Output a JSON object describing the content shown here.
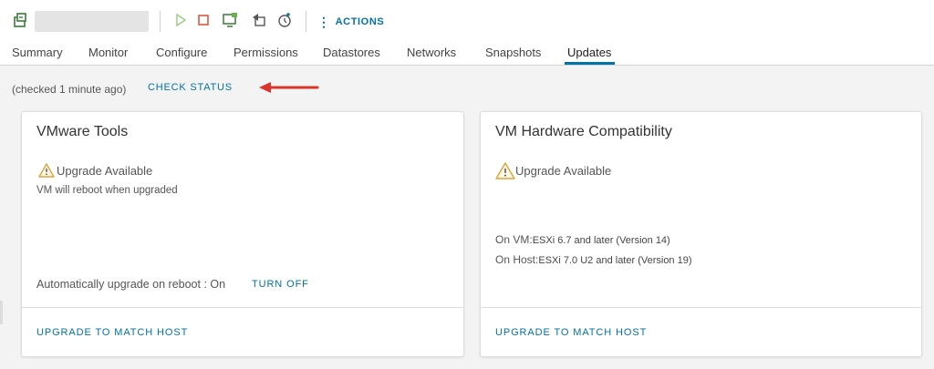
{
  "toolbar": {
    "icons": [
      "vm-icon",
      "power-on-icon",
      "power-off-icon",
      "console-icon",
      "migrate-icon",
      "snapshot-icon",
      "more-vertical-icon"
    ],
    "actions_label": "ACTIONS"
  },
  "tabs": [
    {
      "label": "Summary"
    },
    {
      "label": "Monitor"
    },
    {
      "label": "Configure"
    },
    {
      "label": "Permissions"
    },
    {
      "label": "Datastores"
    },
    {
      "label": "Networks"
    },
    {
      "label": "Snapshots"
    },
    {
      "label": "Updates",
      "active": true
    }
  ],
  "status": {
    "checked_text": "(checked 1 minute ago)",
    "check_status_label": "CHECK STATUS"
  },
  "cards": {
    "tools": {
      "title": "VMware Tools",
      "warning": "Upgrade Available",
      "note": "VM will reboot when upgraded",
      "auto_upgrade": "Automatically upgrade on reboot : On",
      "turn_off_label": "TURN OFF",
      "footer_link": "UPGRADE TO MATCH HOST"
    },
    "hardware": {
      "title": "VM Hardware Compatibility",
      "warning": "Upgrade Available",
      "on_vm_label": "On VM:",
      "on_vm_value": "ESXi 6.7 and later (Version 14)",
      "on_host_label": "On Host:",
      "on_host_value": "ESXi 7.0 U2 and later (Version 19)",
      "footer_link": "UPGRADE TO MATCH HOST"
    }
  },
  "colors": {
    "link": "#0072a3",
    "warning": "#e0a23a",
    "arrow": "#d9352b",
    "power_on": "#7fbf5a",
    "power_off": "#e0573f"
  }
}
